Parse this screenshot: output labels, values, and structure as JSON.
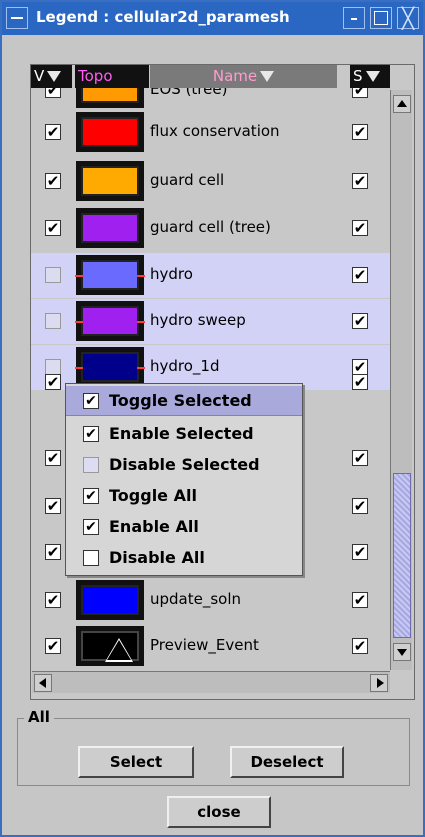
{
  "window": {
    "title": "Legend : cellular2d_paramesh"
  },
  "header": {
    "v_label": "V",
    "topo_label": "Topo",
    "name_label": "Name",
    "s_label": "S"
  },
  "rows": [
    {
      "name": "EOS (tree)",
      "color": "#ff9a00",
      "v": "✔",
      "s": "✔",
      "selected": false
    },
    {
      "name": "flux conservation",
      "color": "#ff0000",
      "v": "✔",
      "s": "✔",
      "selected": false
    },
    {
      "name": "guard cell",
      "color": "#ffaa00",
      "v": "✔",
      "s": "✔",
      "selected": false
    },
    {
      "name": "guard cell (tree)",
      "color": "#a020f0",
      "v": "✔",
      "s": "✔",
      "selected": false
    },
    {
      "name": "hydro",
      "color": "#6a6aff",
      "v": "",
      "s": "✔",
      "selected": true
    },
    {
      "name": "hydro sweep",
      "color": "#a020f0",
      "v": "",
      "s": "✔",
      "selected": true
    },
    {
      "name": "hydro_1d",
      "color": "#00008b",
      "v": "",
      "s": "✔",
      "selected": true
    },
    {
      "name": "",
      "color": "",
      "v": "✔",
      "s": "✔",
      "selected": false
    },
    {
      "name": "",
      "color": "",
      "v": "✔",
      "s": "✔",
      "selected": false
    },
    {
      "name": "",
      "color": "",
      "v": "✔",
      "s": "✔",
      "selected": false
    },
    {
      "name": "",
      "color": "",
      "v": "✔",
      "s": "✔",
      "selected": false
    },
    {
      "name": "update_soln",
      "color": "#0000ff",
      "v": "✔",
      "s": "✔",
      "selected": false
    },
    {
      "name": "Preview_Event",
      "color": "#000000",
      "v": "✔",
      "s": "✔",
      "selected": false,
      "icon": "triangle-icon"
    }
  ],
  "context_menu": {
    "items": [
      {
        "label": "Toggle Selected",
        "check": "✔"
      },
      {
        "label": "Enable Selected",
        "check": "✔"
      },
      {
        "label": "Disable Selected",
        "check": ""
      },
      {
        "label": "Toggle All",
        "check": "✔"
      },
      {
        "label": "Enable All",
        "check": "✔"
      },
      {
        "label": "Disable All",
        "check": ""
      }
    ]
  },
  "group": {
    "legend": "All",
    "select_label": "Select",
    "deselect_label": "Deselect"
  },
  "footer": {
    "close_label": "close"
  }
}
